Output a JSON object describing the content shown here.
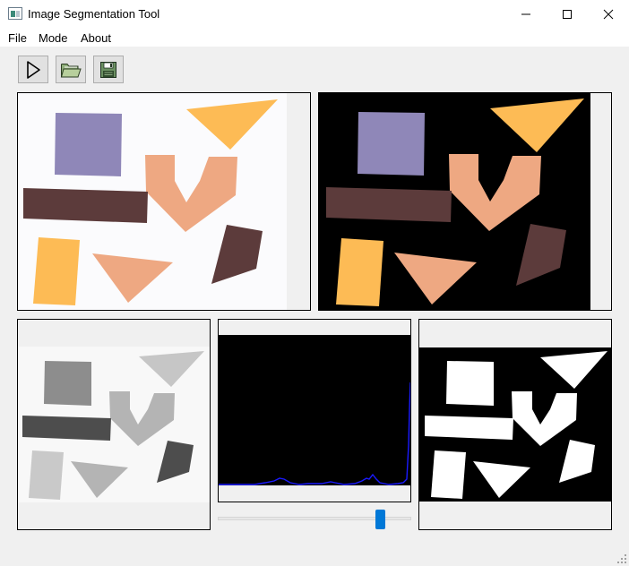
{
  "window": {
    "title": "Image Segmentation Tool",
    "icon": "app-window-icon",
    "controls": [
      "minimize-icon",
      "maximize-icon",
      "close-icon"
    ]
  },
  "menu": {
    "file": "File",
    "mode": "Mode",
    "about": "About"
  },
  "toolbar": {
    "run_icon": "play-icon",
    "open_icon": "folder-open-icon",
    "save_icon": "floppy-disk-icon"
  },
  "panels": {
    "original": "original color image",
    "segmented": "color image with black background",
    "grayscale": "grayscale image",
    "histogram": "intensity histogram",
    "mask": "binary mask"
  },
  "threshold_slider": {
    "value_fraction": 0.86
  },
  "colors": {
    "histogram_line": "#1a1aff",
    "slider_handle": "#0078d7",
    "lavender": "#8f87b8",
    "orange": "#fdbb55",
    "salmon": "#eea882",
    "brown": "#5c3b3b"
  }
}
